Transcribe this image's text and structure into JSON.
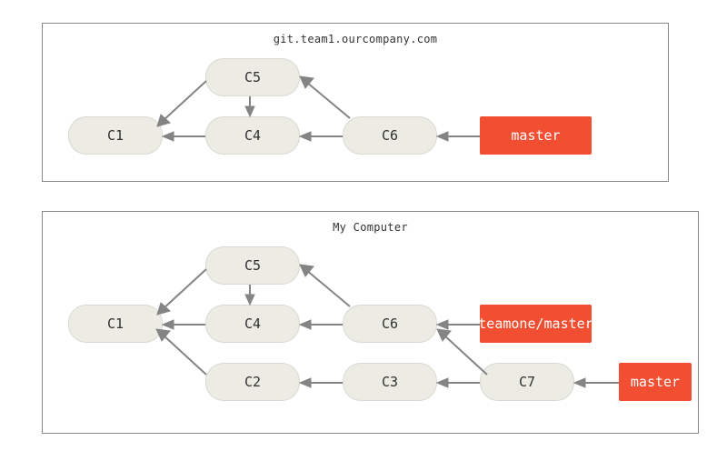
{
  "panels": {
    "remote": {
      "title": "git.team1.ourcompany.com"
    },
    "local": {
      "title": "My Computer"
    }
  },
  "commits": {
    "c1": "C1",
    "c2": "C2",
    "c3": "C3",
    "c4": "C4",
    "c5": "C5",
    "c6": "C6",
    "c7": "C7"
  },
  "branches": {
    "remote_master": "master",
    "teamone_master": "teamone/master",
    "local_master": "master"
  },
  "graph": {
    "remote": {
      "nodes": [
        "C1",
        "C4",
        "C5",
        "C6"
      ],
      "edges": [
        [
          "C4",
          "C1"
        ],
        [
          "C5",
          "C1"
        ],
        [
          "C5",
          "C4"
        ],
        [
          "C6",
          "C4"
        ],
        [
          "C6",
          "C5"
        ]
      ],
      "refs": [
        [
          "master",
          "C6"
        ]
      ]
    },
    "local": {
      "nodes": [
        "C1",
        "C2",
        "C3",
        "C4",
        "C5",
        "C6",
        "C7"
      ],
      "edges": [
        [
          "C4",
          "C1"
        ],
        [
          "C5",
          "C1"
        ],
        [
          "C2",
          "C1"
        ],
        [
          "C5",
          "C4"
        ],
        [
          "C6",
          "C4"
        ],
        [
          "C6",
          "C5"
        ],
        [
          "C3",
          "C2"
        ],
        [
          "C7",
          "C3"
        ],
        [
          "C7",
          "C6"
        ]
      ],
      "refs": [
        [
          "teamone/master",
          "C6"
        ],
        [
          "master",
          "C7"
        ]
      ]
    }
  },
  "colors": {
    "commit_bg": "#ecece5",
    "branch_bg": "#f14e32",
    "arrow": "#848484",
    "panel_border": "#888888"
  }
}
